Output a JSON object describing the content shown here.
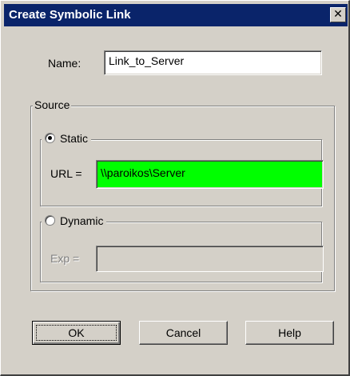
{
  "window": {
    "title": "Create Symbolic Link",
    "close_glyph": "✕"
  },
  "name_field": {
    "label": "Name:",
    "value": "Link_to_Server"
  },
  "source": {
    "label": "Source",
    "static": {
      "label": "Static",
      "selected": true,
      "url_label": "URL =",
      "url_value": "\\\\paroikos\\Server",
      "url_bg": "#00ff00"
    },
    "dynamic": {
      "label": "Dynamic",
      "selected": false,
      "exp_label": "Exp =",
      "exp_value": ""
    }
  },
  "buttons": {
    "ok": "OK",
    "cancel": "Cancel",
    "help": "Help"
  },
  "colors": {
    "titlebar": "#0a246a",
    "face": "#d4d0c8"
  }
}
